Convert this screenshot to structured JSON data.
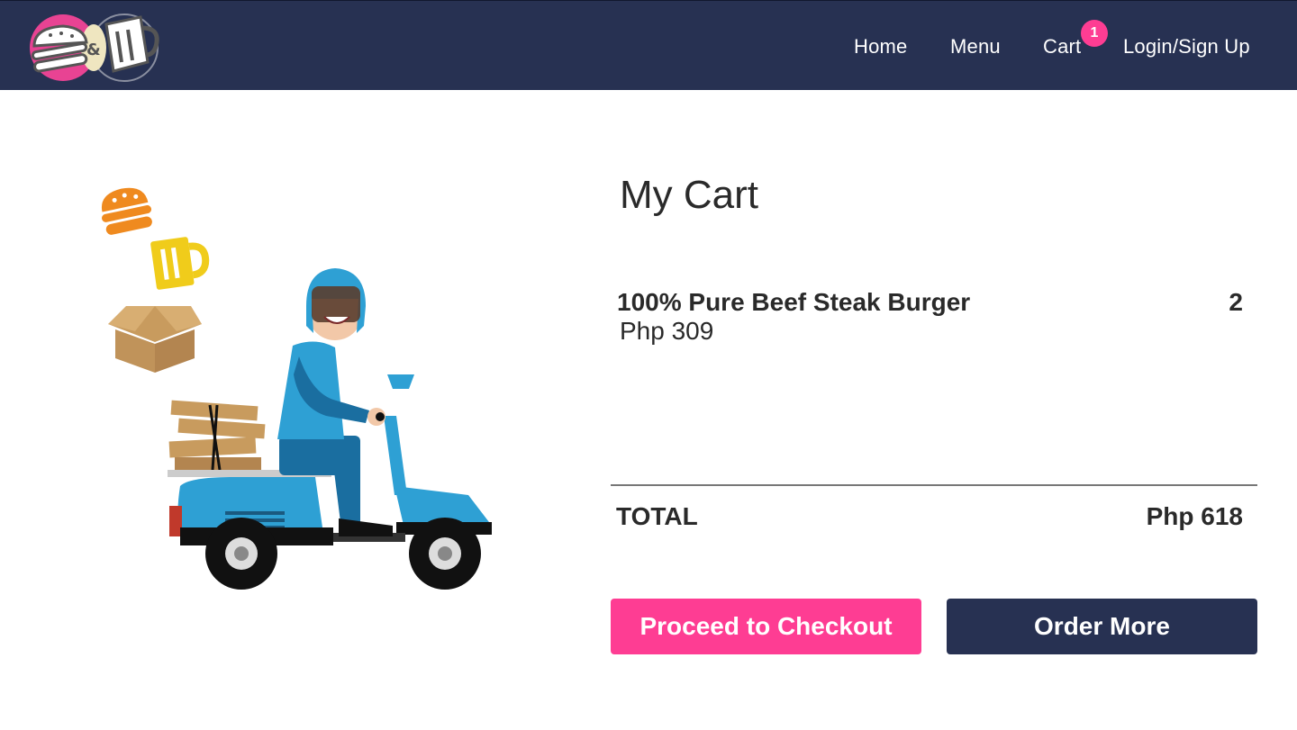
{
  "colors": {
    "navbar": "#273152",
    "accent_pink": "#fe3d93",
    "text": "#2a2a2a"
  },
  "nav": {
    "logo_icon": "burger-and-beer-logo-icon",
    "links": [
      "Home",
      "Menu",
      "Cart",
      "Login/Sign Up"
    ],
    "cart_count": "1"
  },
  "cart": {
    "title": "My Cart",
    "items": [
      {
        "name": "100% Pure Beef Steak Burger",
        "price": "Php 309",
        "quantity": "2"
      }
    ],
    "total_label": "TOTAL",
    "total_value": "Php 618",
    "checkout_label": "Proceed to Checkout",
    "order_more_label": "Order More"
  },
  "illustration": {
    "icon": "delivery-scooter-illustration-icon"
  }
}
